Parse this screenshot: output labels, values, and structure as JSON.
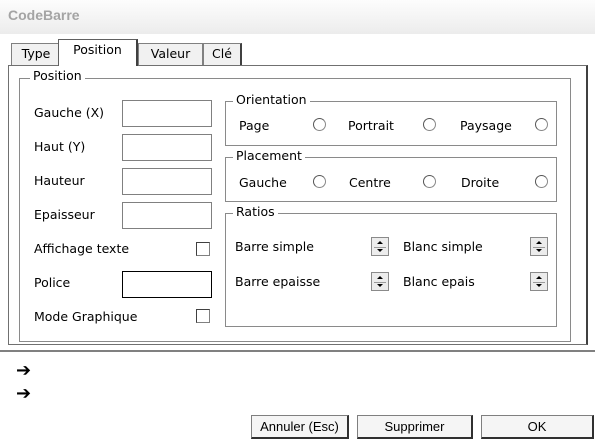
{
  "window": {
    "title": "CodeBarre"
  },
  "tabs": [
    "Type",
    "Position",
    "Valeur",
    "Clé"
  ],
  "position": {
    "legend": "Position",
    "gauche_label": "Gauche (X)",
    "gauche_value": "",
    "haut_label": "Haut (Y)",
    "haut_value": "",
    "hauteur_label": "Hauteur",
    "hauteur_value": "",
    "epaisseur_label": "Epaisseur",
    "epaisseur_value": "",
    "affichage_label": "Affichage texte",
    "affichage_checked": false,
    "police_label": "Police",
    "police_value": "",
    "mode_label": "Mode Graphique",
    "mode_checked": false
  },
  "orientation": {
    "legend": "Orientation",
    "options": [
      "Page",
      "Portrait",
      "Paysage"
    ]
  },
  "placement": {
    "legend": "Placement",
    "options": [
      "Gauche",
      "Centre",
      "Droite"
    ]
  },
  "ratios": {
    "legend": "Ratios",
    "barre_simple": "Barre simple",
    "blanc_simple": "Blanc simple",
    "barre_epaisse": "Barre epaisse",
    "blanc_epais": "Blanc epais"
  },
  "icons": {
    "arrow": "right-arrow-icon"
  },
  "buttons": {
    "cancel": "Annuler (Esc)",
    "delete": "Supprimer",
    "ok": "OK"
  }
}
